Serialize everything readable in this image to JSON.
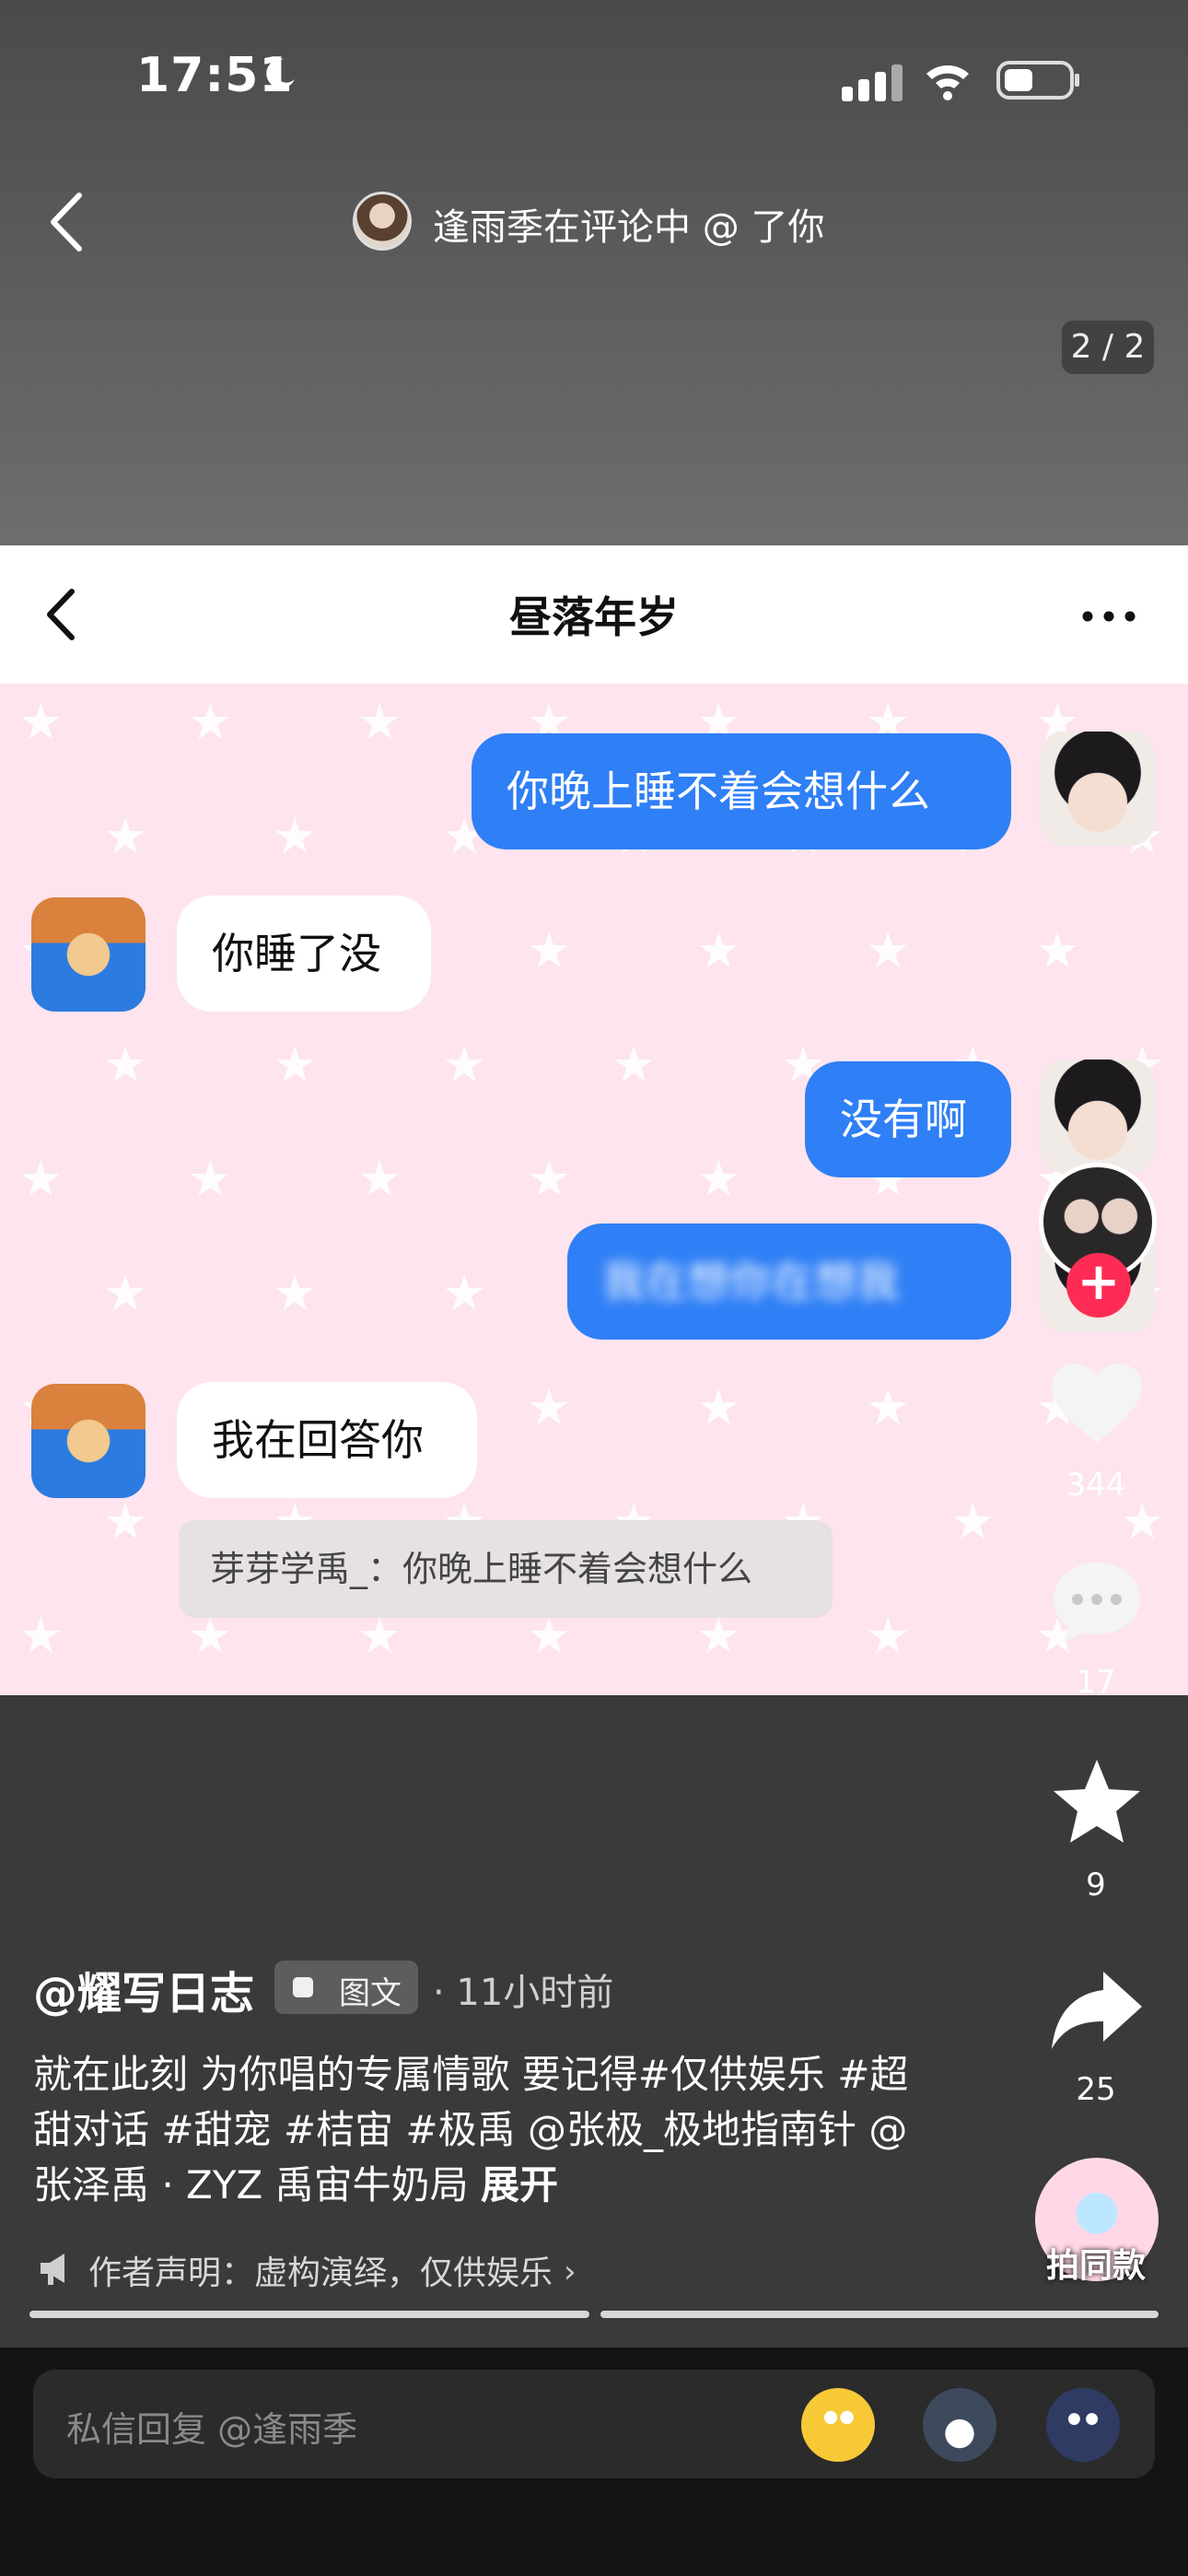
{
  "status_bar": {
    "time": "17:51"
  },
  "notification": {
    "text": "逢雨季在评论中 @ 了你"
  },
  "page_indicator": "2 / 2",
  "chat_screenshot": {
    "title": "昼落年岁",
    "messages": [
      {
        "from": "me",
        "text": "你晚上睡不着会想什么"
      },
      {
        "from": "other",
        "text": "你睡了没"
      },
      {
        "from": "me",
        "text": "没有啊"
      },
      {
        "from": "me",
        "text": "我在想你在想我",
        "blurred": true
      },
      {
        "from": "other",
        "text": "我在回答你"
      }
    ],
    "quote": "芽芽学禹_：你晚上睡不着会想什么"
  },
  "actions": {
    "like_count": "344",
    "comment_count": "17",
    "favorite_count": "9",
    "share_count": "25"
  },
  "post": {
    "author": "@耀写日志",
    "type_tag": "图文",
    "time": "· 11小时前",
    "caption": "就在此刻 为你唱的专属情歌 要记得#仅供娱乐 #超甜对话 #甜宠 #桔宙 #极禹 @张极_极地指南针 @张泽禹 · ZYZ 禹宙牛奶局",
    "expand_label": "展开",
    "disclaimer": "作者声明：虚构演绎，仅供娱乐",
    "same_style_label": "拍同款"
  },
  "reply": {
    "placeholder": "私信回复 @逢雨季"
  },
  "colors": {
    "accent_blue": "#2f7ff6",
    "follow_red": "#fe2c55",
    "chat_bg": "#fde4ee"
  }
}
